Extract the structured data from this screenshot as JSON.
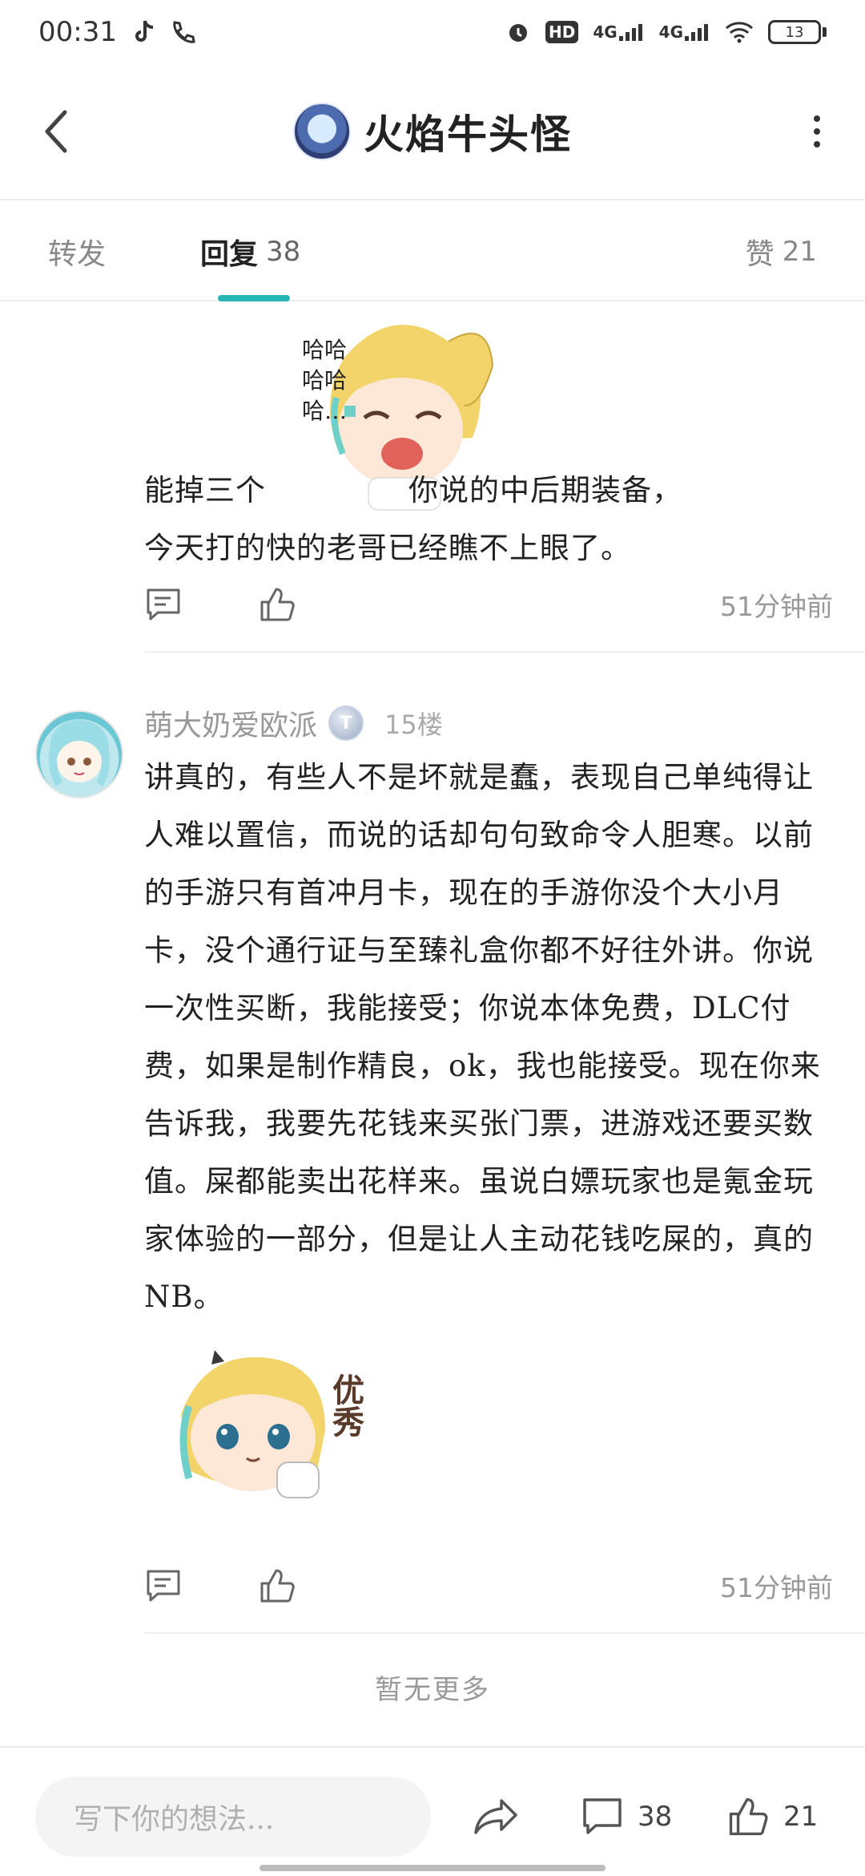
{
  "status_bar": {
    "time": "00:31",
    "battery": "13",
    "network_1": "4G",
    "network_2": "4G",
    "hd_label": "HD"
  },
  "header": {
    "title": "火焰牛头怪"
  },
  "tabs": {
    "forward_label": "转发",
    "reply_label": "回复",
    "reply_count": "38",
    "like_label": "赞",
    "like_count": "21"
  },
  "posts": [
    {
      "text_line1_a": "能掉三个",
      "text_line1_b": "你说的中后期装备，",
      "text_line2": "今天打的快的老哥已经瞧不上眼了。",
      "sticker_caption": "哈哈哈哈哈…",
      "time": "51分钟前"
    },
    {
      "username": "萌大奶爱欧派",
      "level": "T",
      "floor": "15楼",
      "body": "讲真的，有些人不是坏就是蠢，表现自己单纯得让人难以置信，而说的话却句句致命令人胆寒。以前的手游只有首冲月卡，现在的手游你没个大小月卡，没个通行证与至臻礼盒你都不好往外讲。你说一次性买断，我能接受；你说本体免费，DLC付费，如果是制作精良，ok，我也能接受。现在你来告诉我，我要先花钱来买张门票，进游戏还要买数值。屎都能卖出花样来。虽说白嫖玩家也是氪金玩家体验的一部分，但是让人主动花钱吃屎的，真的NB。",
      "sticker_caption": "优秀",
      "time": "51分钟前"
    }
  ],
  "no_more": "暂无更多",
  "bottom_bar": {
    "input_placeholder": "写下你的想法...",
    "comment_count": "38",
    "like_count": "21"
  },
  "colors": {
    "accent": "#27b6b4"
  }
}
